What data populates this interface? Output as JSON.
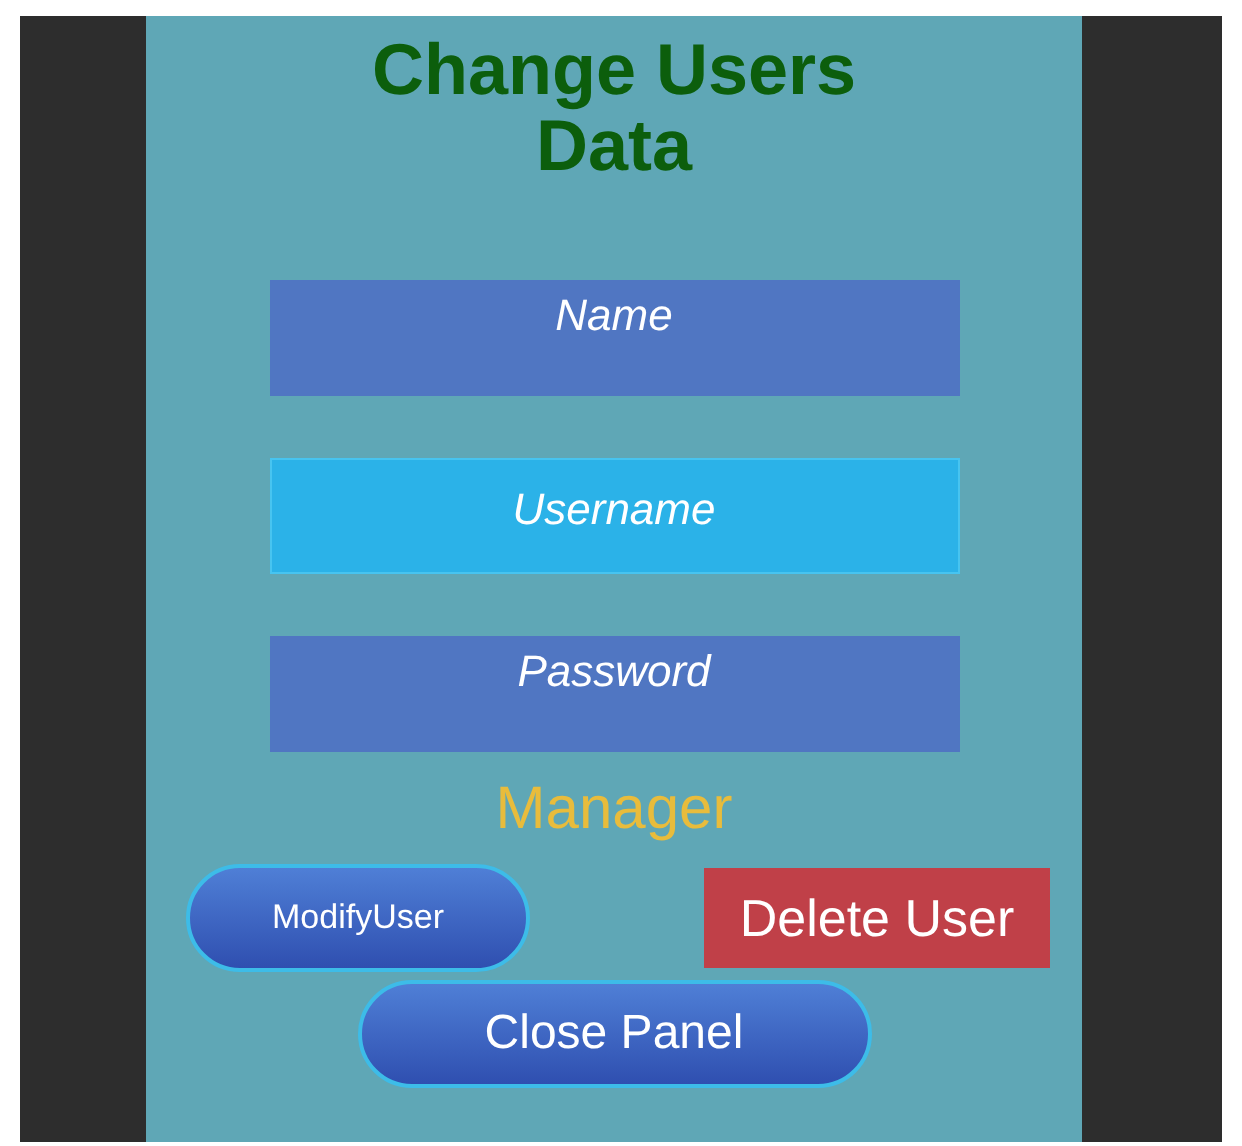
{
  "title": "Change Users Data",
  "fields": [
    {
      "placeholder": "Name",
      "focused": false
    },
    {
      "placeholder": "Username",
      "focused": true
    },
    {
      "placeholder": "Password",
      "focused": false
    }
  ],
  "role_label": "Manager",
  "buttons": [
    {
      "label": "ModifyUser",
      "kind": "pill"
    },
    {
      "label": "Delete User",
      "kind": "danger"
    },
    {
      "label": "Close Panel",
      "kind": "pill"
    }
  ]
}
